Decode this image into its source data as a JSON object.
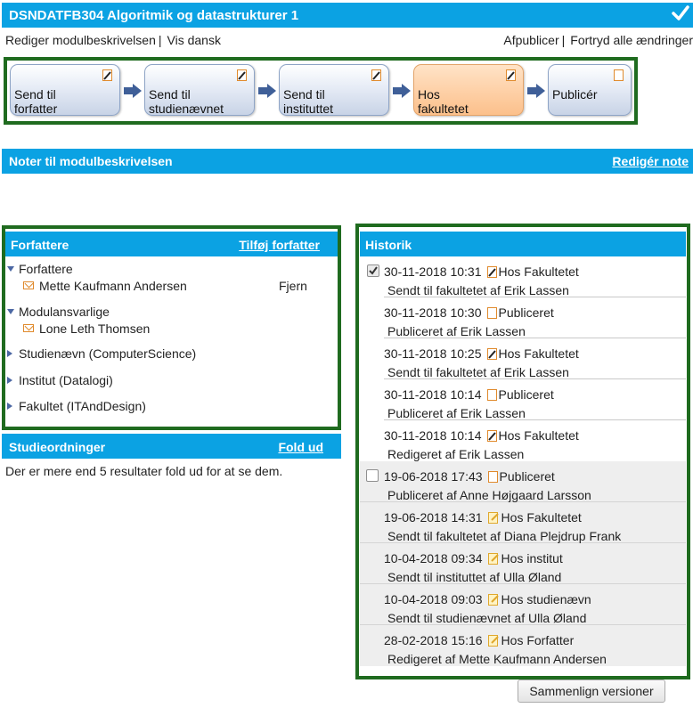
{
  "header": {
    "title": "DSNDATFB304 Algoritmik og datastrukturer 1",
    "check_icon": "checkmark-icon"
  },
  "toolbar": {
    "edit_description": "Rediger modulbeskrivelsen",
    "separator": "|",
    "show_danish": "Vis dansk",
    "unpublish": "Afpublicer",
    "undo_all": "Fortryd alle ændringer"
  },
  "workflow": {
    "steps": [
      {
        "line1": "Send til",
        "line2": "forfatter",
        "icon": "edit-document-icon"
      },
      {
        "line1": "Send til",
        "line2": "studienævnet",
        "icon": "edit-document-icon"
      },
      {
        "line1": "Send til",
        "line2": "instituttet",
        "icon": "edit-document-icon"
      },
      {
        "line1": "Hos",
        "line2": "fakultetet",
        "icon": "edit-document-icon"
      },
      {
        "line1": "Publicér",
        "line2": "",
        "icon": "document-icon"
      }
    ]
  },
  "notes": {
    "title": "Noter til modulbeskrivelsen",
    "edit_link": "Redigér note"
  },
  "authors": {
    "title": "Forfattere",
    "add_link": "Tilføj forfatter",
    "groups": [
      {
        "label": "Forfattere",
        "members": [
          "Mette Kaufmann Andersen"
        ],
        "action": "Fjern"
      },
      {
        "label": "Modulansvarlige",
        "members": [
          "Lone Leth Thomsen"
        ]
      },
      {
        "label": "Studienævn (ComputerScience)"
      },
      {
        "label": "Institut (Datalogi)"
      },
      {
        "label": "Fakultet (ITAndDesign)"
      }
    ]
  },
  "study": {
    "title": "Studieordninger",
    "expand_link": "Fold ud",
    "message": "Der er mere end 5 resultater fold ud for at se dem."
  },
  "history": {
    "title": "Historik",
    "rows": [
      {
        "datetime": "30-11-2018 10:31",
        "status": "Hos Fakultetet",
        "detail": "Sendt til fakultetet af Erik Lassen"
      },
      {
        "datetime": "30-11-2018 10:30",
        "status": "Publiceret",
        "detail": "Publiceret af Erik Lassen"
      },
      {
        "datetime": "30-11-2018 10:25",
        "status": "Hos Fakultetet",
        "detail": "Sendt til fakultetet af Erik Lassen"
      },
      {
        "datetime": "30-11-2018 10:14",
        "status": "Publiceret",
        "detail": "Publiceret af Erik Lassen"
      },
      {
        "datetime": "30-11-2018 10:14",
        "status": "Hos Fakultetet",
        "detail": "Redigeret af Erik Lassen"
      },
      {
        "datetime": "19-06-2018 17:43",
        "status": "Publiceret",
        "detail": "Publiceret af Anne Højgaard Larsson"
      },
      {
        "datetime": "19-06-2018 14:31",
        "status": "Hos Fakultetet",
        "detail": "Sendt til fakultetet af Diana Plejdrup Frank"
      },
      {
        "datetime": "10-04-2018 09:34",
        "status": "Hos institut",
        "detail": "Sendt til instituttet af Ulla Øland"
      },
      {
        "datetime": "10-04-2018 09:03",
        "status": "Hos studienævn",
        "detail": "Sendt til studienævnet af Ulla Øland"
      },
      {
        "datetime": "28-02-2018 15:16",
        "status": "Hos Forfatter",
        "detail": "Redigeret af Mette Kaufmann Andersen"
      }
    ],
    "compare_button": "Sammenlign versioner"
  },
  "colors": {
    "accent": "#0ba2e3",
    "frame": "#1f6b1f",
    "active_step": "#fcc08b"
  }
}
